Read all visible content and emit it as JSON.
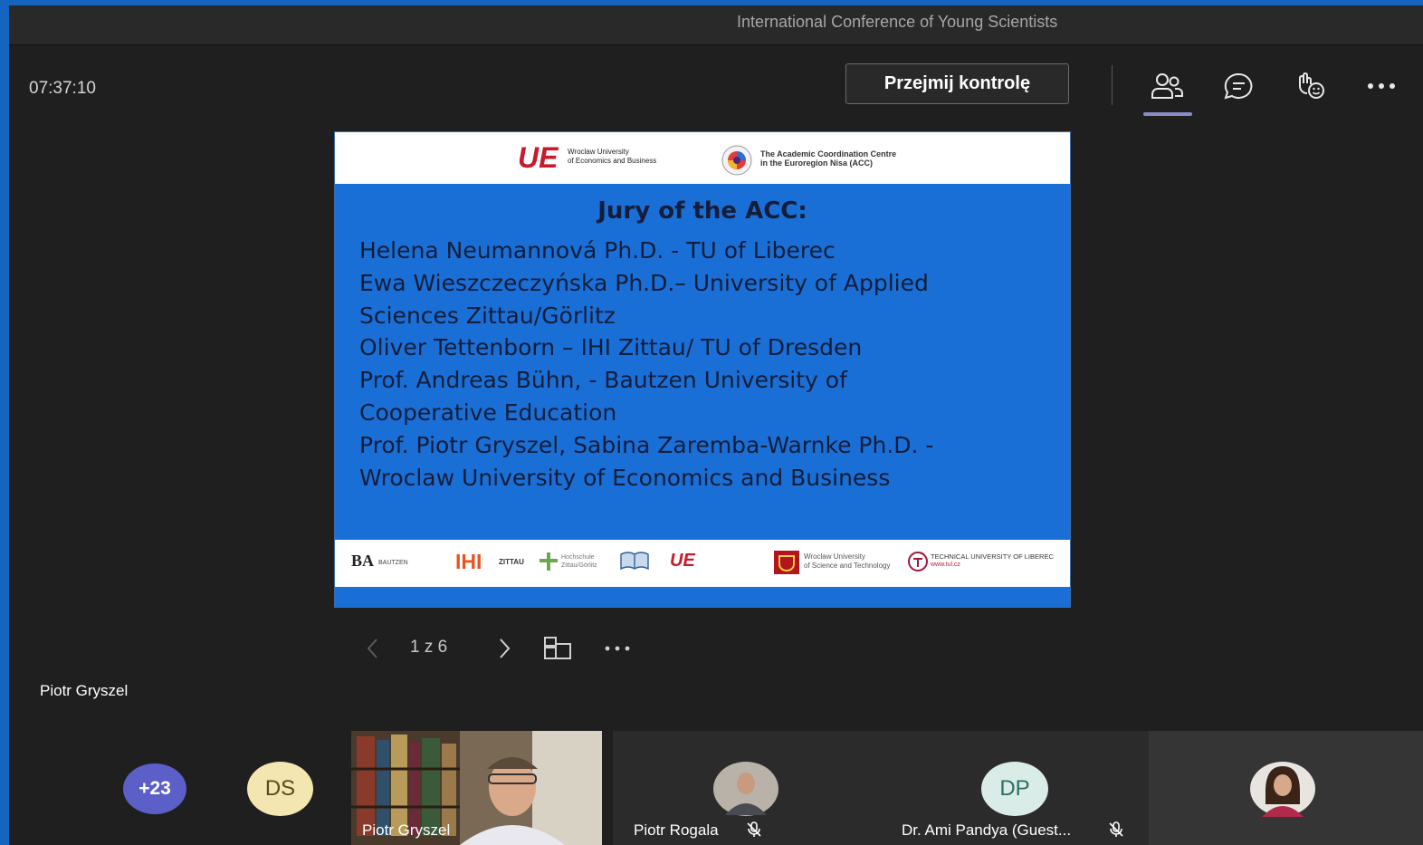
{
  "window": {
    "title": "International Conference of Young Scientists"
  },
  "toolbar": {
    "timer": "07:37:10",
    "take_control_label": "Przejmij kontrolę",
    "icons": [
      "people-icon",
      "chat-icon",
      "reactions-icon",
      "more-icon"
    ]
  },
  "slide": {
    "header_logos": {
      "ue_mark": "UE",
      "ue_name_line1": "Wroclaw University",
      "ue_name_line2": "of Economics and Business",
      "acc_line1": "The Academic Coordination Centre",
      "acc_line2": "in the Euroregion Nisa (ACC)"
    },
    "heading": "Jury of the ACC:",
    "lines": [
      "Helena Neumannová Ph.D. - TU of Liberec",
      "Ewa Wieszczeczyńska Ph.D.– University of Applied",
      "Sciences Zittau/Görlitz",
      "Oliver Tettenborn – IHI Zittau/ TU of Dresden",
      "Prof. Andreas Bühn, - Bautzen University of",
      "Cooperative Education",
      "Prof. Piotr Gryszel, Sabina Zaremba-Warnke Ph.D. -",
      "Wroclaw University of Economics and Business"
    ],
    "footer_logos": {
      "ba": "BA",
      "ba_sub": "BAUTZEN",
      "ihi": "IHI",
      "zittau": "ZITTAU",
      "hochschule": "Hochschule Zittau/Görlitz",
      "ue_mark": "UE",
      "wust_line1": "Wroclaw University",
      "wust_line2": "of Science and Technology",
      "tul_line1": "TECHNICAL UNIVERSITY OF LIBEREC",
      "tul_line2": "www.tul.cz"
    }
  },
  "slide_nav": {
    "page_count": "1 z 6"
  },
  "stage": {
    "presenter_name": "Piotr Gryszel"
  },
  "gallery": {
    "overflow_count": "+23",
    "participants": [
      {
        "initials": "DS",
        "name": "",
        "muted": false
      },
      {
        "initials": "",
        "name": "Piotr Gryszel",
        "muted": false
      },
      {
        "initials": "",
        "name": "Piotr Rogala",
        "muted": true
      },
      {
        "initials": "DP",
        "name": "Dr. Ami Pandya (Guest...",
        "muted": true
      },
      {
        "initials": "",
        "name": "",
        "muted": false
      }
    ]
  },
  "colors": {
    "frame_border": "#1565c0",
    "slide_blue": "#1a6fd6",
    "overflow_avatar": "#5b5fc7",
    "ds_avatar": "#f3e6b0",
    "dp_avatar": "#d9ece8"
  }
}
